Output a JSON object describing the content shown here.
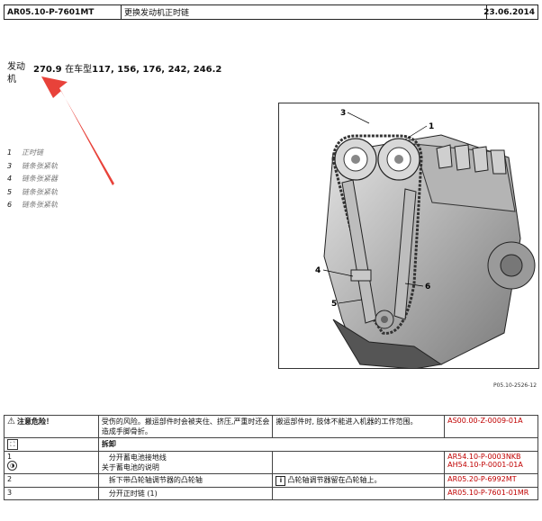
{
  "header": {
    "doc_id": "AR05.10-P-7601MT",
    "title": "更换发动机正时链",
    "date": "23.06.2014"
  },
  "engine": {
    "label": "发动机",
    "code": "270.9",
    "in_model_text": "在车型",
    "models": "117, 156, 176, 242, 246.2"
  },
  "legend": [
    {
      "num": "1",
      "text": "正时链"
    },
    {
      "num": "3",
      "text": "链条张紧轨"
    },
    {
      "num": "4",
      "text": "链条张紧器"
    },
    {
      "num": "5",
      "text": "链条张紧轨"
    },
    {
      "num": "6",
      "text": "链条张紧轨"
    }
  ],
  "figure": {
    "callouts": [
      "3",
      "1",
      "4",
      "6",
      "5"
    ],
    "caption": "P05.10-2526-12"
  },
  "table": {
    "warning": {
      "title": "注意危险！",
      "risk": "受伤的风险。搬运部件时会被夹住、挤压,严重时还会造成手脚骨折。",
      "measure": "搬运部件时, 肢体不能进入机器的工作范围。",
      "ref": "AS00.00-Z-0009-01A"
    },
    "removal_label": "拆卸",
    "steps": [
      {
        "num": "1",
        "lines": [
          "分开蓄电池接地线",
          "关于蓄电池的说明"
        ],
        "refs": [
          "AR54.10-P-0003NKB",
          "AH54.10-P-0001-01A"
        ],
        "note": ""
      },
      {
        "num": "2",
        "lines": [
          "拆下带凸轮轴调节器的凸轮轴"
        ],
        "refs": [
          "AR05.20-P-6992MT"
        ],
        "note": "凸轮轴调节器留在凸轮轴上。"
      },
      {
        "num": "3",
        "lines": [
          "分开正时链 (1)"
        ],
        "refs": [
          "AR05.10-P-7601-01MR"
        ],
        "note": ""
      }
    ]
  }
}
